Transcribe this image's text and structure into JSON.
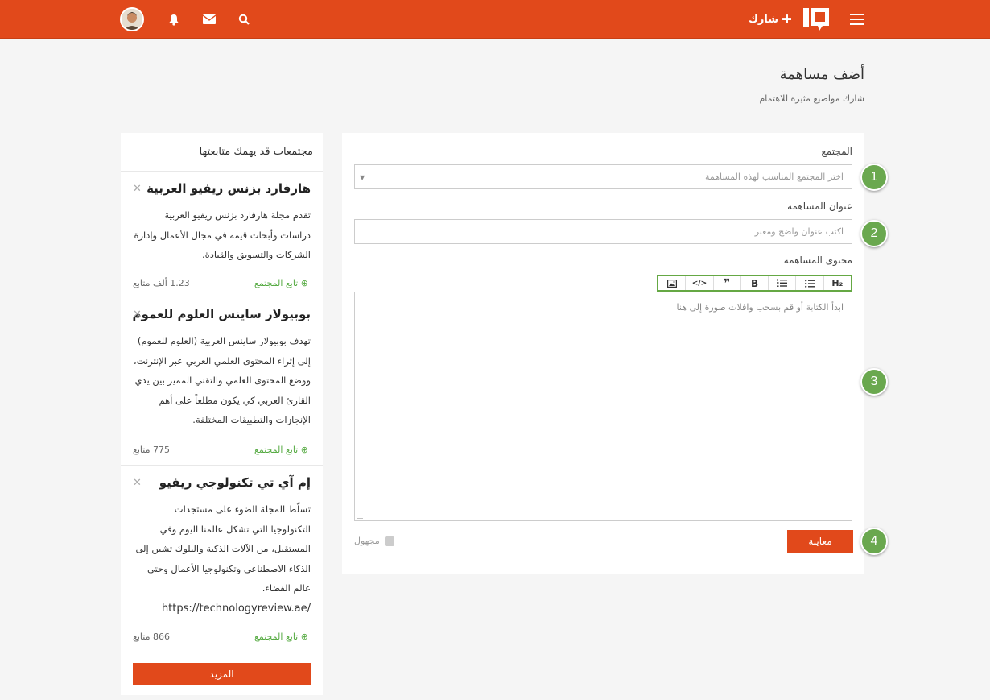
{
  "header": {
    "share_label": "شارك",
    "share_icon": "plus-icon",
    "icons": [
      "menu-icon",
      "logo",
      "search-icon",
      "envelope-icon",
      "bell-icon",
      "avatar"
    ]
  },
  "page": {
    "title": "أضف مساهمة",
    "subtitle": "شارك مواضيع مثيرة للاهتمام"
  },
  "form": {
    "community_label": "المجتمع",
    "community_placeholder": "اختر المجتمع المناسب لهذه المساهمة",
    "title_label": "عنوان المساهمة",
    "title_placeholder": "اكتب عنوان واضح ومعبر",
    "content_label": "محتوى المساهمة",
    "editor_placeholder": "ابدأ الكتابة أو قم بسحب وافلات صورة إلى هنا",
    "toolbar": [
      "H2",
      "list",
      "ordered-list",
      "B",
      "quote",
      "code",
      "image"
    ],
    "toolbar_labels": {
      "h2": "H₂",
      "bold": "B",
      "quote": "❞",
      "code": "</>"
    },
    "preview_label": "معاينة",
    "anonymous_label": "مجهول",
    "steps": [
      "1",
      "2",
      "3",
      "4"
    ]
  },
  "sidebar": {
    "title": "مجتمعات قد يهمك متابعتها",
    "follow_label": "تابع المجتمع",
    "more_label": "المزيد",
    "communities": [
      {
        "name": "هارفارد بزنس ريفيو العربية",
        "description": "تقدم مجلة هارفارد بزنس ريفيو العربية دراسات وأبحاث قيمة في مجال الأعمال وإدارة الشركات والتسويق والقيادة.",
        "followers": "1.23 ألف متابع"
      },
      {
        "name": "بوبيولار ساينس العلوم للعموم",
        "description": "تهدف بوبيولار ساينس العربية (العلوم للعموم) إلى إثراء المحتوى العلمي العربي عبر الإنترنت، ووضع المحتوى العلمي والتقني المميز بين يدي القارئ العربي كي يكون مطلعاً على أهم الإنجازات والتطبيقات المختلفة.",
        "followers": "775 متابع"
      },
      {
        "name": "إم آي تي تكنولوجي ريفيو",
        "description": "تسلّط المجلة الضوء على مستجدات التكنولوجيا التي تشكل عالمنا اليوم وفي المستقبل، من الآلات الذكية والبلوك تشين إلى الذكاء الاصطناعي وتكنولوجيا الأعمال وحتى عالم الفضاء.",
        "url": "https://technologyreview.ae/",
        "followers": "866 متابع"
      }
    ]
  },
  "colors": {
    "brand": "#e1491b",
    "accent_green": "#6aa84f",
    "follow_green": "#53a93f"
  }
}
